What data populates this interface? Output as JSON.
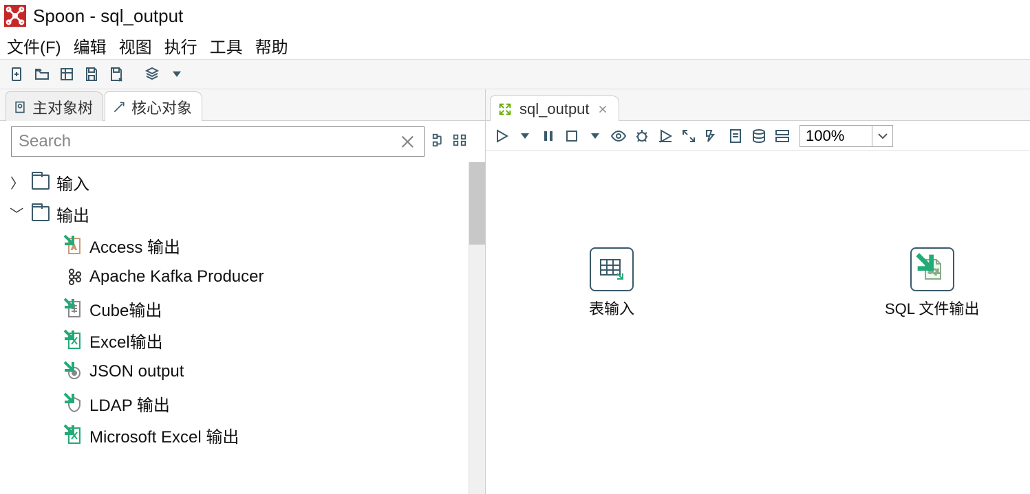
{
  "window": {
    "title": "Spoon - sql_output"
  },
  "menu": {
    "file": "文件(F)",
    "edit": "编辑",
    "view": "视图",
    "run": "执行",
    "tools": "工具",
    "help": "帮助"
  },
  "sidebar": {
    "tabs": {
      "main": "主对象树",
      "core": "核心对象"
    },
    "search_placeholder": "Search",
    "tree": {
      "input": "输入",
      "output": "输出",
      "children": [
        "Access 输出",
        "Apache Kafka Producer",
        "Cube输出",
        "Excel输出",
        "JSON output",
        "LDAP 输出",
        "Microsoft Excel 输出"
      ]
    }
  },
  "editor": {
    "tab": "sql_output",
    "zoom": "100%",
    "steps": {
      "table_input": "表输入",
      "sql_file_output": "SQL 文件输出"
    }
  }
}
